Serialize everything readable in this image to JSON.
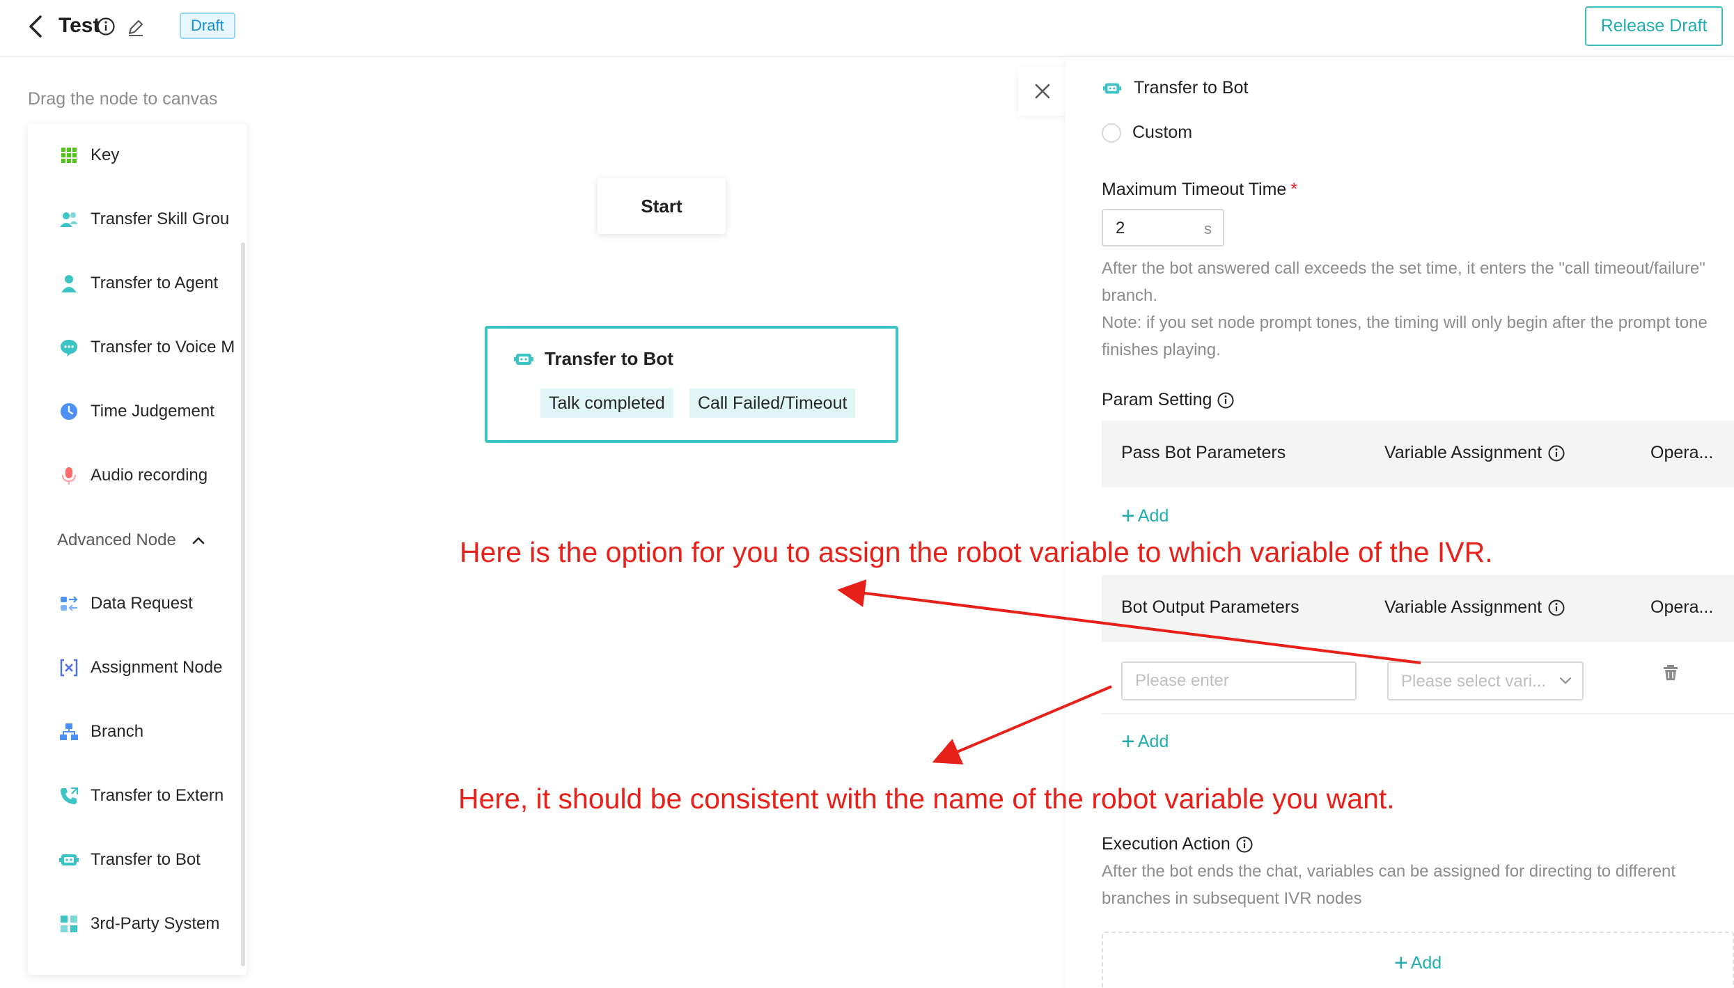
{
  "header": {
    "title": "Test",
    "badge": "Draft",
    "release_label": "Release Draft"
  },
  "palette": {
    "hint": "Drag the node to canvas",
    "items": [
      {
        "label": "Key",
        "icon": "keypad-icon"
      },
      {
        "label": "Transfer Skill Grou",
        "icon": "skill-group-icon"
      },
      {
        "label": "Transfer to Agent",
        "icon": "agent-icon"
      },
      {
        "label": "Transfer to Voice M",
        "icon": "voicemail-icon"
      },
      {
        "label": "Time Judgement",
        "icon": "clock-icon"
      },
      {
        "label": "Audio recording",
        "icon": "microphone-icon"
      }
    ],
    "advanced_label": "Advanced Node",
    "advanced_items": [
      {
        "label": "Data Request",
        "icon": "data-request-icon"
      },
      {
        "label": "Assignment Node",
        "icon": "assignment-icon"
      },
      {
        "label": "Branch",
        "icon": "branch-icon"
      },
      {
        "label": "Transfer to Extern",
        "icon": "phone-transfer-icon"
      },
      {
        "label": "Transfer to Bot",
        "icon": "bot-icon"
      },
      {
        "label": "3rd-Party System",
        "icon": "third-party-icon"
      }
    ]
  },
  "canvas": {
    "start_label": "Start",
    "bot_node": {
      "title": "Transfer to Bot",
      "branches": [
        "Talk completed",
        "Call Failed/Timeout"
      ]
    }
  },
  "panel": {
    "title": "Transfer to Bot",
    "radio_label": "Custom",
    "timeout_label": "Maximum Timeout Time",
    "timeout_required": "*",
    "timeout_value": "2",
    "timeout_unit": "s",
    "timeout_help_1": "After the bot answered call exceeds the set time, it enters the \"call timeout/failure\" branch.",
    "timeout_help_2": "Note: if you set node prompt tones, the timing will only begin after the prompt tone finishes playing.",
    "param_setting_label": "Param Setting",
    "pass_table": {
      "col1": "Pass Bot Parameters",
      "col2": "Variable Assignment",
      "col3": "Opera..."
    },
    "add_label": "Add",
    "output_table": {
      "col1": "Bot Output Parameters",
      "col2": "Variable Assignment",
      "col3": "Opera..."
    },
    "output_row": {
      "param_placeholder": "Please enter",
      "variable_placeholder": "Please select vari..."
    },
    "execution_label": "Execution Action",
    "execution_help": "After the bot ends the chat, variables can be assigned for directing to different branches in subsequent IVR nodes"
  },
  "annotations": {
    "note_1": "Here is the option for you to assign the robot variable to which variable of the IVR.",
    "note_2": "Here, it should be consistent with the name of the robot variable you want.",
    "color": "#e8201a"
  },
  "colors": {
    "accent": "#22adb0",
    "node_border": "#3cc3c5",
    "draft_blue": "#1890d4"
  }
}
